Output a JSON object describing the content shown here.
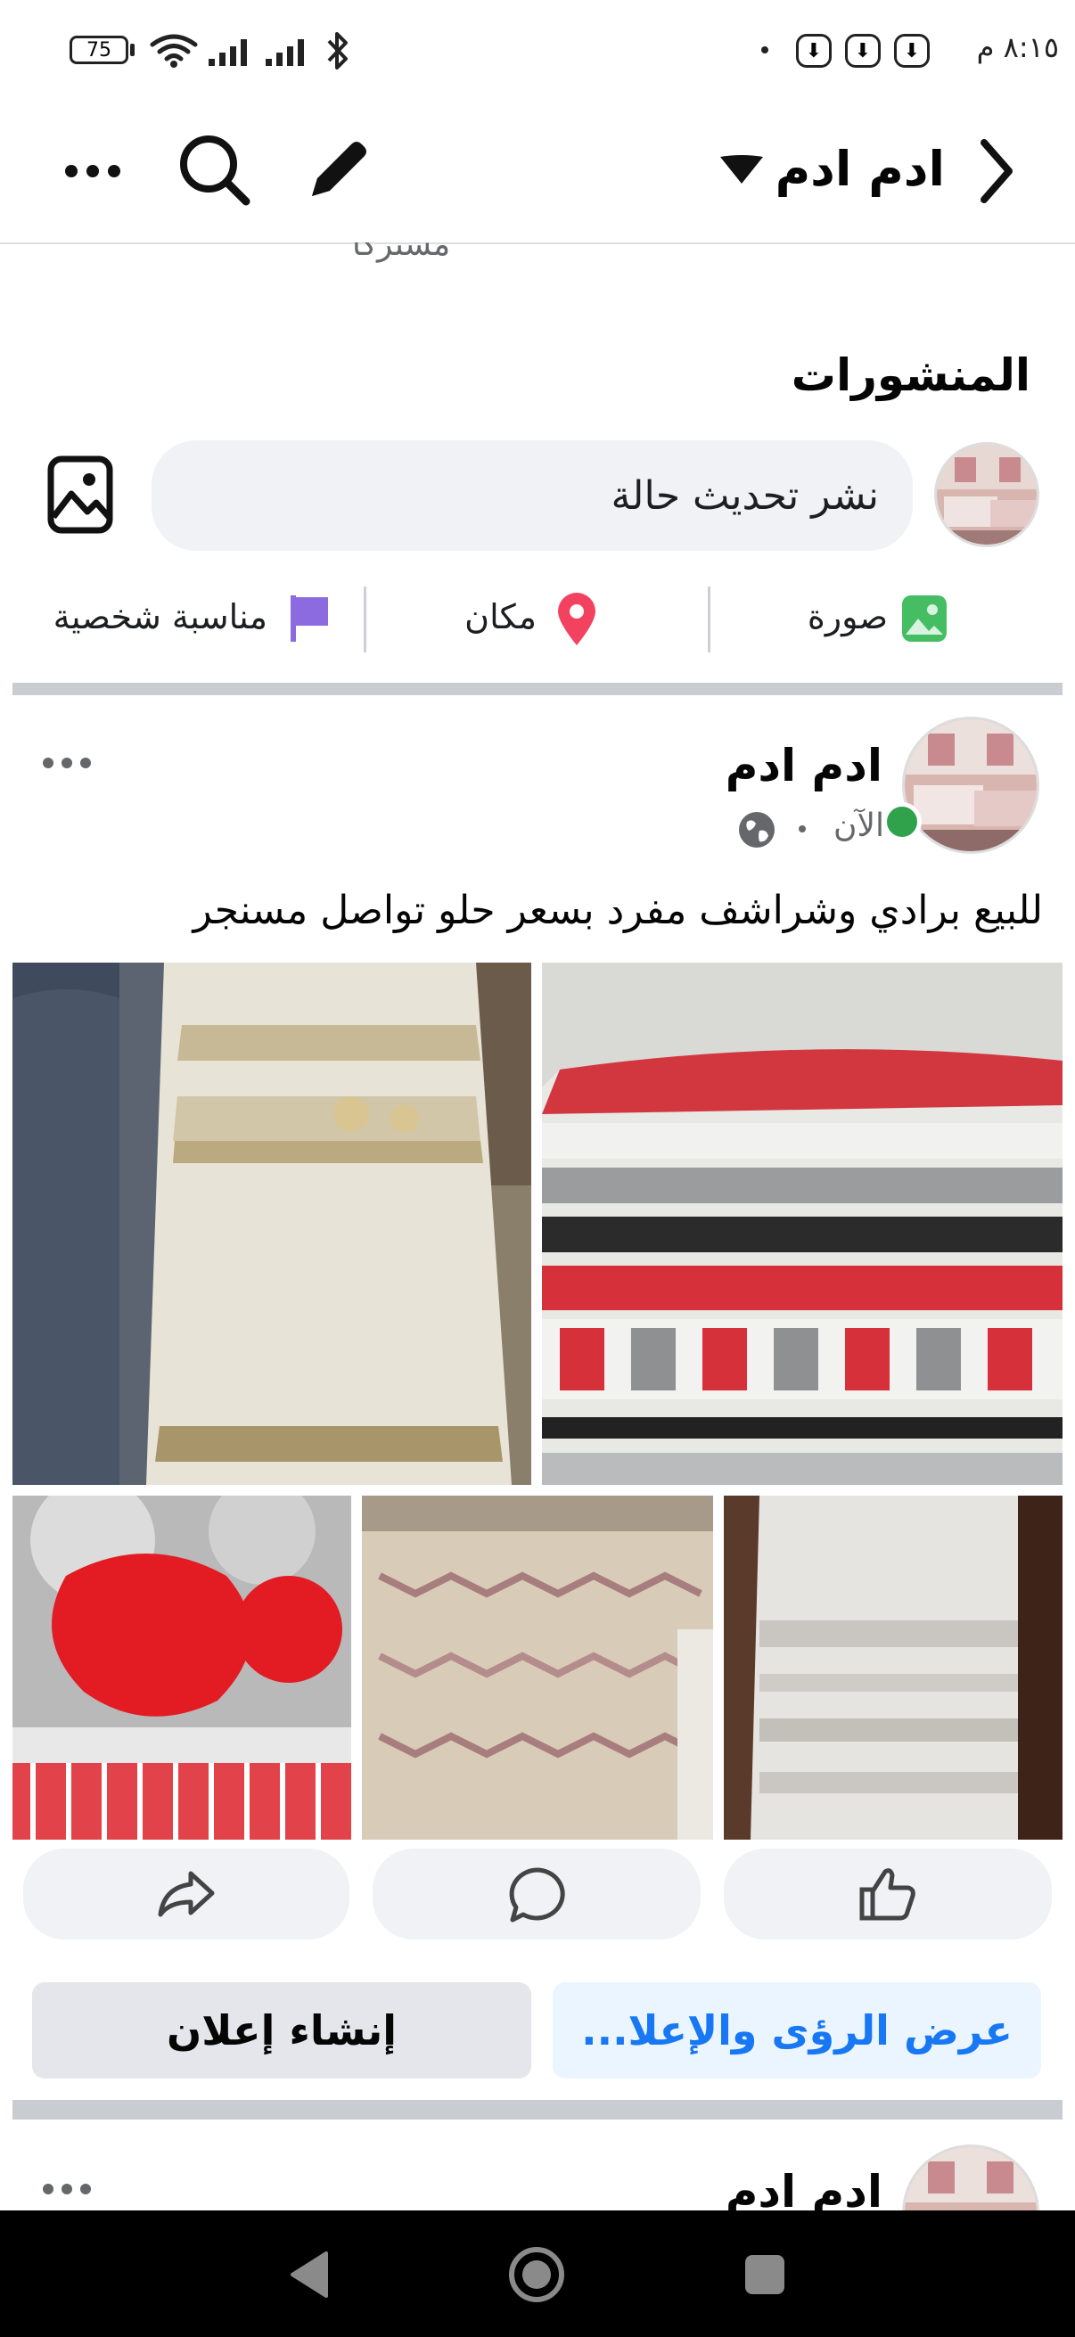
{
  "status_bar": {
    "battery": "75",
    "time": "٨:١٥ م"
  },
  "top_bar": {
    "profile_name": "ادم ادم"
  },
  "section": {
    "partial_text": "مشتركا",
    "posts_title": "المنشورات"
  },
  "composer": {
    "placeholder": "نشر تحديث حالة",
    "actions": [
      {
        "label": "صورة"
      },
      {
        "label": "مكان"
      },
      {
        "label": "مناسبة شخصية"
      }
    ]
  },
  "post": {
    "author": "ادم ادم",
    "time": "الآن",
    "text": "للبيع برادي وشراشف مفرد بسعر حلو تواصل مسنجر",
    "cta_insights": "عرض الرؤى والإعلا...",
    "cta_ad": "إنشاء إعلان"
  },
  "next_post": {
    "author": "ادم ادم"
  },
  "colors": {
    "accent": "#1877f2",
    "online": "#31a24c",
    "photo_green": "#45bd62",
    "place_red": "#f3425f",
    "flag_purple": "#8c6be0"
  }
}
